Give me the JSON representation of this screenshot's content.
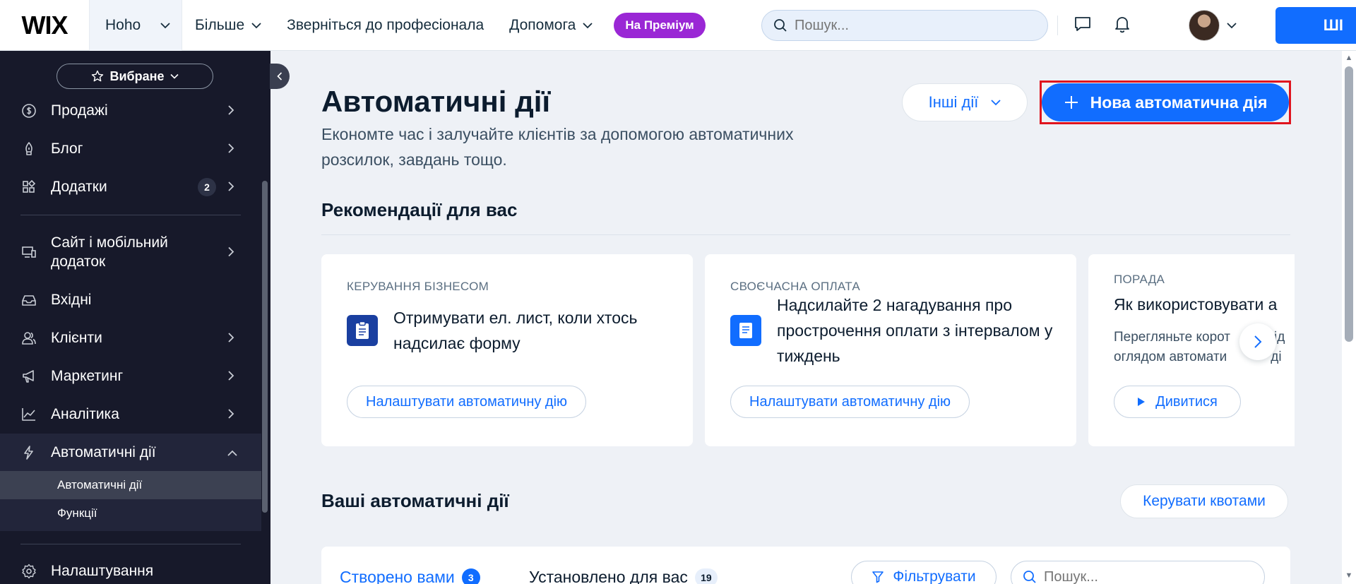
{
  "topbar": {
    "logo": "WIX",
    "site_name": "Hoho",
    "nav": [
      "Більше",
      "Зверніться до професіонала",
      "Допомога"
    ],
    "premium": "На Преміум",
    "search_placeholder": "Пошук...",
    "upgrade_label": "ШІ"
  },
  "sidebar": {
    "favorites": "Вибране",
    "items": {
      "sales": "Продажі",
      "blog": "Блог",
      "apps": "Додатки",
      "apps_badge": "2",
      "site": "Сайт і мобільний додаток",
      "inbox": "Вхідні",
      "clients": "Клієнти",
      "marketing": "Маркетинг",
      "analytics": "Аналітика",
      "automations": "Автоматичні дії",
      "settings": "Налаштування"
    },
    "sub": [
      "Автоматичні дії",
      "Функції"
    ]
  },
  "main": {
    "title": "Автоматичні дії",
    "subtitle": "Економте час і залучайте клієнтів за допомогою автоматичних розсилок, завдань тощо.",
    "other_actions": "Інші дії",
    "new_automation": "Нова автоматична дія",
    "recommendations_title": "Рекомендації для вас",
    "cards": [
      {
        "category": "КЕРУВАННЯ БІЗНЕСОМ",
        "text": "Отримувати ел. лист, коли хтось надсилає форму",
        "button": "Налаштувати автоматичну дію",
        "icon_color": "#1a3fa0"
      },
      {
        "category": "СВОЄЧАСНА ОПЛАТА",
        "text": "Надсилайте 2 нагадування про прострочення оплати з інтервалом у тиждень",
        "button": "Налаштувати автоматичну дію",
        "icon_color": "#116dff"
      }
    ],
    "tip_card": {
      "category": "ПОРАДА",
      "title": "Як використовувати а",
      "desc_line1": "Перегляньте корот",
      "desc_tail1": "ід",
      "desc_line2": "оглядом автомати",
      "desc_tail2": "ді",
      "button": "Дивитися"
    },
    "your_title": "Ваші автоматичні дії",
    "manage_quotas": "Керувати квотами",
    "tabs": [
      {
        "label": "Створено вами",
        "count": "3"
      },
      {
        "label": "Установлено для вас",
        "count": "19"
      }
    ],
    "filter": "Фільтрувати",
    "table_search_placeholder": "Пошук..."
  },
  "colors": {
    "accent": "#116dff",
    "premium": "#9a27d5",
    "sidebar_bg": "#17192a",
    "highlight": "#e0141e"
  }
}
